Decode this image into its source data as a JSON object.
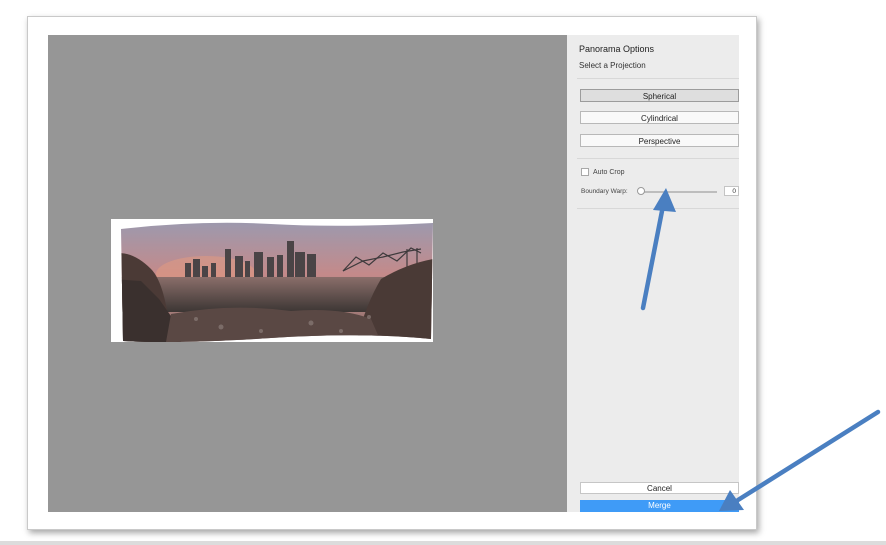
{
  "panel": {
    "title": "Panorama Options",
    "subtitle": "Select a Projection",
    "projections": [
      "Spherical",
      "Cylindrical",
      "Perspective"
    ],
    "selected_projection": "Spherical",
    "auto_crop_label": "Auto Crop",
    "auto_crop_checked": false,
    "boundary_warp_label": "Boundary Warp:",
    "boundary_warp_value": "0",
    "cancel_label": "Cancel",
    "merge_label": "Merge"
  },
  "colors": {
    "accent": "#3f9bf7",
    "annotation_arrow": "#4a7fc1",
    "preview_background": "#969696"
  }
}
